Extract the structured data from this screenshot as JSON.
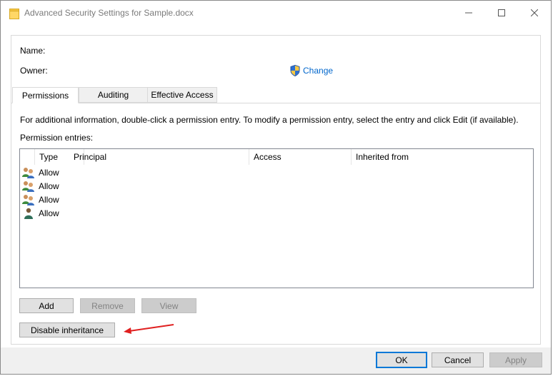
{
  "window": {
    "title": "Advanced Security Settings for Sample.docx",
    "controls": [
      "minimize",
      "maximize",
      "close"
    ]
  },
  "owner_section": {
    "name_label": "Name:",
    "owner_label": "Owner:",
    "change_link": "Change"
  },
  "tabs": [
    {
      "label": "Permissions",
      "active": true
    },
    {
      "label": "Auditing",
      "active": false
    },
    {
      "label": "Effective Access",
      "active": false
    }
  ],
  "permissions": {
    "info_text": "For additional information, double-click a permission entry. To modify a permission entry, select the entry and click Edit (if available).",
    "entries_label": "Permission entries:",
    "columns": [
      "Type",
      "Principal",
      "Access",
      "Inherited from"
    ],
    "rows": [
      {
        "icon": "group-users-icon",
        "type": "Allow"
      },
      {
        "icon": "group-users-icon",
        "type": "Allow"
      },
      {
        "icon": "group-users-icon",
        "type": "Allow"
      },
      {
        "icon": "single-user-icon",
        "type": "Allow"
      }
    ],
    "buttons": {
      "add": "Add",
      "remove": "Remove",
      "view": "View",
      "disable_inheritance": "Disable inheritance"
    }
  },
  "footer": {
    "ok": "OK",
    "cancel": "Cancel",
    "apply": "Apply"
  },
  "colors": {
    "link": "#0066cc",
    "accent": "#0078d7",
    "annotation_arrow": "#e02020"
  }
}
